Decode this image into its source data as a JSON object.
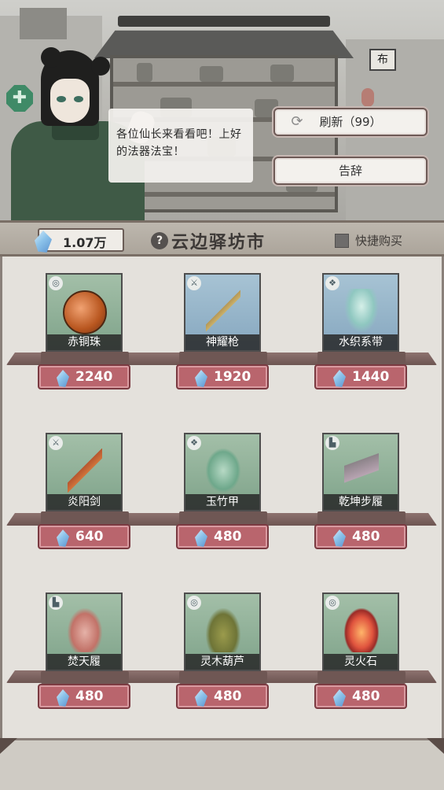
{
  "scene": {
    "sign_char": "布",
    "dialog_text": "各位仙长来看看吧！上好的法器法宝！"
  },
  "actions": {
    "refresh_label": "刷新（99）",
    "leave_label": "告辞"
  },
  "header": {
    "currency_amount": "1.07万",
    "help_symbol": "?",
    "shop_title": "云边驿坊市",
    "quickbuy_label": "快捷购买"
  },
  "items": [
    {
      "name": "赤铜珠",
      "price": "2240",
      "frame": "green",
      "type_icon": "ring-icon"
    },
    {
      "name": "神耀枪",
      "price": "1920",
      "frame": "blue",
      "type_icon": "weapon-icon"
    },
    {
      "name": "水织系带",
      "price": "1440",
      "frame": "blue",
      "type_icon": "clothing-icon"
    },
    {
      "name": "炎阳剑",
      "price": "640",
      "frame": "green",
      "type_icon": "weapon-icon"
    },
    {
      "name": "玉竹甲",
      "price": "480",
      "frame": "green",
      "type_icon": "clothing-icon"
    },
    {
      "name": "乾坤步履",
      "price": "480",
      "frame": "green",
      "type_icon": "boot-icon"
    },
    {
      "name": "焚天履",
      "price": "480",
      "frame": "green",
      "type_icon": "boot-icon"
    },
    {
      "name": "灵木葫芦",
      "price": "480",
      "frame": "green",
      "type_icon": "ring-icon"
    },
    {
      "name": "灵火石",
      "price": "480",
      "frame": "green",
      "type_icon": "ring-icon"
    }
  ],
  "colors": {
    "price_bg": "#b9656d",
    "frame_green": "#8fb19a",
    "frame_blue": "#96b5ca"
  }
}
